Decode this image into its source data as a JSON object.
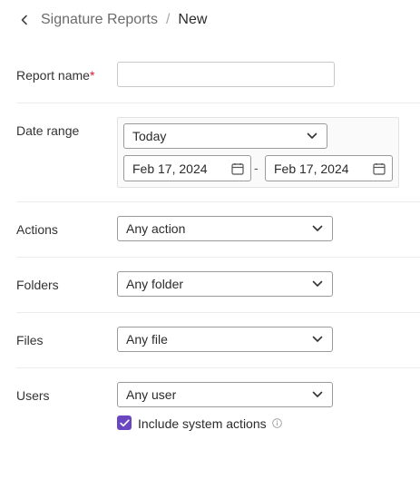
{
  "header": {
    "back_icon": "chevron-left-icon",
    "parent": "Signature Reports",
    "separator": "/",
    "current": "New"
  },
  "form": {
    "report_name": {
      "label": "Report name",
      "required_mark": "*",
      "value": "",
      "placeholder": ""
    },
    "date_range": {
      "label": "Date range",
      "preset": "Today",
      "start": "Feb 17, 2024",
      "separator": "-",
      "end": "Feb 17, 2024",
      "calendar_icon": "calendar-icon"
    },
    "actions": {
      "label": "Actions",
      "value": "Any action"
    },
    "folders": {
      "label": "Folders",
      "value": "Any folder"
    },
    "files": {
      "label": "Files",
      "value": "Any file"
    },
    "users": {
      "label": "Users",
      "value": "Any user"
    },
    "include_system": {
      "label": "Include system actions",
      "checked": true,
      "info_icon": "info-icon"
    }
  },
  "colors": {
    "accent": "#6b46c1",
    "required": "#d81b3a",
    "divider": "#ececec"
  }
}
